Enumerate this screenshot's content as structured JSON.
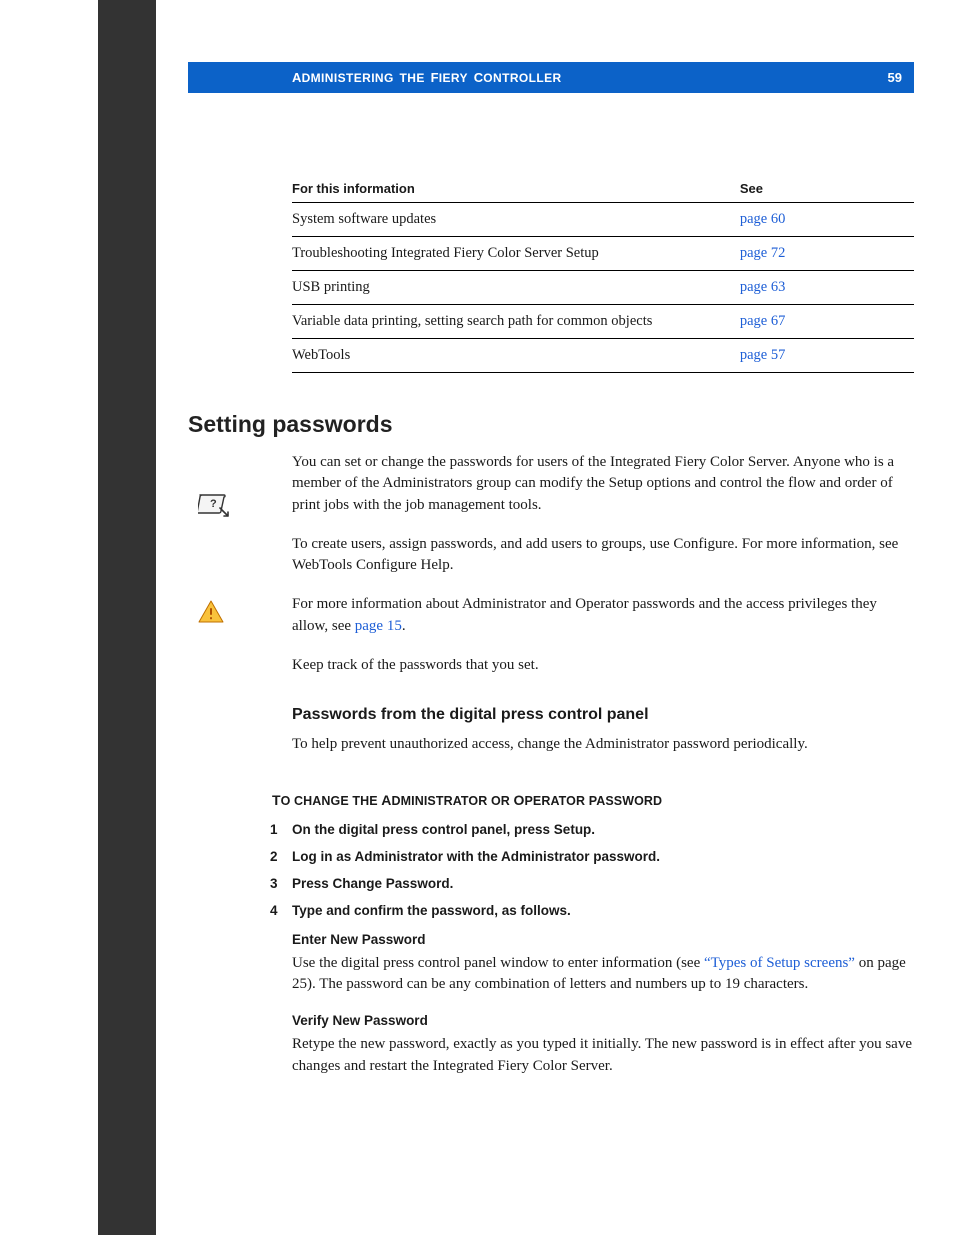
{
  "banner": {
    "title_caps": "A",
    "title_rest_1": "DMINISTERING",
    "title_caps2": "F",
    "title_rest_2": "IERY",
    "title_caps3": "C",
    "title_rest_3": "ONTROLLER",
    "the": "THE",
    "page_number": "59"
  },
  "table": {
    "head_left": "For this information",
    "head_right": "See",
    "rows": [
      {
        "label": "System software updates",
        "link": "page 60"
      },
      {
        "label": "Troubleshooting Integrated Fiery Color Server Setup",
        "link": "page 72"
      },
      {
        "label": "USB printing",
        "link": "page 63"
      },
      {
        "label": "Variable data printing, setting search path for common objects",
        "link": "page 67"
      },
      {
        "label": "WebTools",
        "link": "page 57"
      }
    ]
  },
  "section_heading": "Setting passwords",
  "para1": "You can set or change the passwords for users of the Integrated Fiery Color Server. Anyone who is a member of the Administrators group can modify the Setup options and control the flow and order of print jobs with the job management tools.",
  "para2": "To create users, assign passwords, and add users to groups, use Configure. For more information, see WebTools Configure Help.",
  "para3_a": "For more information about Administrator and Operator passwords and the access privileges they allow, see ",
  "para3_link": "page 15",
  "para3_b": ".",
  "para4": "Keep track of the passwords that you set.",
  "subheading": "Passwords from the digital press control panel",
  "para5": "To help prevent unauthorized access, change the Administrator password periodically.",
  "procedure_title_words": [
    "T",
    "O CHANGE THE ",
    "A",
    "DMINISTRATOR OR ",
    "O",
    "PERATOR PASSWORD"
  ],
  "steps": [
    {
      "n": "1",
      "t": "On the digital press control panel, press Setup."
    },
    {
      "n": "2",
      "t": "Log in as Administrator with the Administrator password."
    },
    {
      "n": "3",
      "t": "Press Change Password."
    },
    {
      "n": "4",
      "t": "Type and confirm the password, as follows."
    }
  ],
  "field1_label": "Enter New Password",
  "field1_body_a": "Use the digital press control panel window to enter information (see ",
  "field1_link": "“Types of Setup screens”",
  "field1_body_b": " on page 25). The password can be any combination of letters and numbers up to 19 characters.",
  "field2_label": "Verify New Password",
  "field2_body": "Retype the new password, exactly as you typed it initially. The new password is in effect after you save changes and restart the Integrated Fiery Color Server."
}
